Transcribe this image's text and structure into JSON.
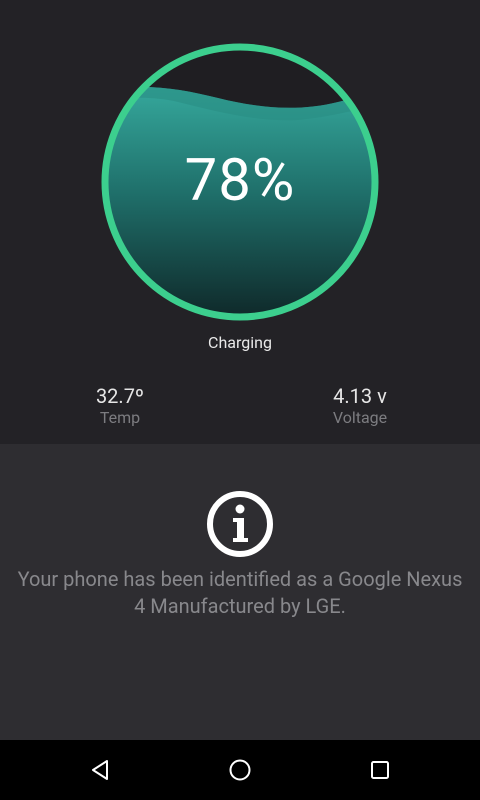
{
  "battery": {
    "level_percent": 78,
    "percent_label": "78%",
    "status": "Charging",
    "colors": {
      "ring": "#3ccf8e",
      "fill_top": "#2e9e94",
      "fill_bottom": "#0f2a2b"
    }
  },
  "stats": {
    "temp": {
      "value": "32.7º",
      "label": "Temp"
    },
    "voltage": {
      "value": "4.13 v",
      "label": "Voltage"
    }
  },
  "info": {
    "icon": "info-circle-icon",
    "message": "Your phone has been identified as a Google Nexus 4 Manufactured by LGE."
  },
  "navbar": {
    "buttons": [
      {
        "icon": "back-triangle-icon"
      },
      {
        "icon": "home-circle-icon"
      },
      {
        "icon": "recent-apps-square-icon"
      }
    ]
  }
}
